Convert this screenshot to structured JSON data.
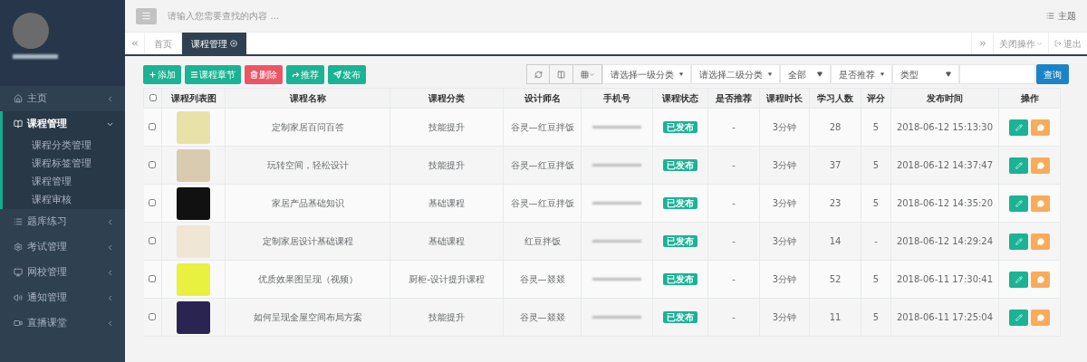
{
  "sidebar": {
    "items": [
      {
        "label": "主页",
        "expanded": false,
        "selected": false
      },
      {
        "label": "课程管理",
        "expanded": true,
        "selected": true,
        "children": [
          {
            "label": "课程分类管理"
          },
          {
            "label": "课程标签管理"
          },
          {
            "label": "课程管理"
          },
          {
            "label": "课程审核"
          }
        ]
      },
      {
        "label": "题库练习",
        "expanded": false,
        "selected": false
      },
      {
        "label": "考试管理",
        "expanded": false,
        "selected": false
      },
      {
        "label": "网校管理",
        "expanded": false,
        "selected": false
      },
      {
        "label": "通知管理",
        "expanded": false,
        "selected": false
      },
      {
        "label": "直播课堂",
        "expanded": false,
        "selected": false
      }
    ]
  },
  "header": {
    "search_placeholder": "请输入您需要查找的内容 …",
    "theme_label": "主题"
  },
  "tabs": [
    {
      "label": "首页",
      "selected": false
    },
    {
      "label": "课程管理",
      "selected": true
    }
  ],
  "tab_actions": {
    "close_label": "关闭操作",
    "logout_label": "退出"
  },
  "toolbar": {
    "buttons": [
      {
        "label": "添加",
        "kind": "add"
      },
      {
        "label": "课程章节",
        "kind": "chapters"
      },
      {
        "label": "删除",
        "kind": "delete"
      },
      {
        "label": "推荐",
        "kind": "recommend"
      },
      {
        "label": "发布",
        "kind": "publish"
      }
    ],
    "selects": [
      "请选择一级分类",
      "请选择二级分类",
      "全部",
      "是否推荐",
      "类型"
    ],
    "query_label": "查询"
  },
  "table": {
    "all_checked": false,
    "columns": [
      "课程列表图",
      "课程名称",
      "课程分类",
      "设计师名",
      "手机号",
      "课程状态",
      "是否推荐",
      "课程时长",
      "学习人数",
      "评分",
      "发布时间",
      "操作"
    ],
    "rows": [
      {
        "checked": false,
        "name": "定制家居百问百答",
        "category": "技能提升",
        "designer": "谷灵—红豆拌饭",
        "status": "已发布",
        "recommended": "-",
        "duration": "3分钟",
        "learners": "28",
        "rating": "5",
        "published": "2018-06-12 15:13:30"
      },
      {
        "checked": false,
        "name": "玩转空间，轻松设计",
        "category": "技能提升",
        "designer": "谷灵—红豆拌饭",
        "status": "已发布",
        "recommended": "-",
        "duration": "3分钟",
        "learners": "37",
        "rating": "5",
        "published": "2018-06-12 14:37:47"
      },
      {
        "checked": false,
        "name": "家居产品基础知识",
        "category": "基础课程",
        "designer": "谷灵—红豆拌饭",
        "status": "已发布",
        "recommended": "-",
        "duration": "3分钟",
        "learners": "23",
        "rating": "5",
        "published": "2018-06-12 14:35:20"
      },
      {
        "checked": false,
        "name": "定制家居设计基础课程",
        "category": "基础课程",
        "designer": "红豆拌饭",
        "status": "已发布",
        "recommended": "-",
        "duration": "3分钟",
        "learners": "14",
        "rating": "-",
        "published": "2018-06-12 14:29:24"
      },
      {
        "checked": false,
        "name": "优质效果图呈现（视频）",
        "category": "厨柜-设计提升课程",
        "designer": "谷灵—燚燚",
        "status": "已发布",
        "recommended": "-",
        "duration": "3分钟",
        "learners": "52",
        "rating": "5",
        "published": "2018-06-11 17:30:41"
      },
      {
        "checked": false,
        "name": "如何呈现全屋空间布局方案",
        "category": "技能提升",
        "designer": "谷灵—燚燚",
        "status": "已发布",
        "recommended": "-",
        "duration": "3分钟",
        "learners": "11",
        "rating": "5",
        "published": "2018-06-11 17:25:04"
      }
    ]
  }
}
